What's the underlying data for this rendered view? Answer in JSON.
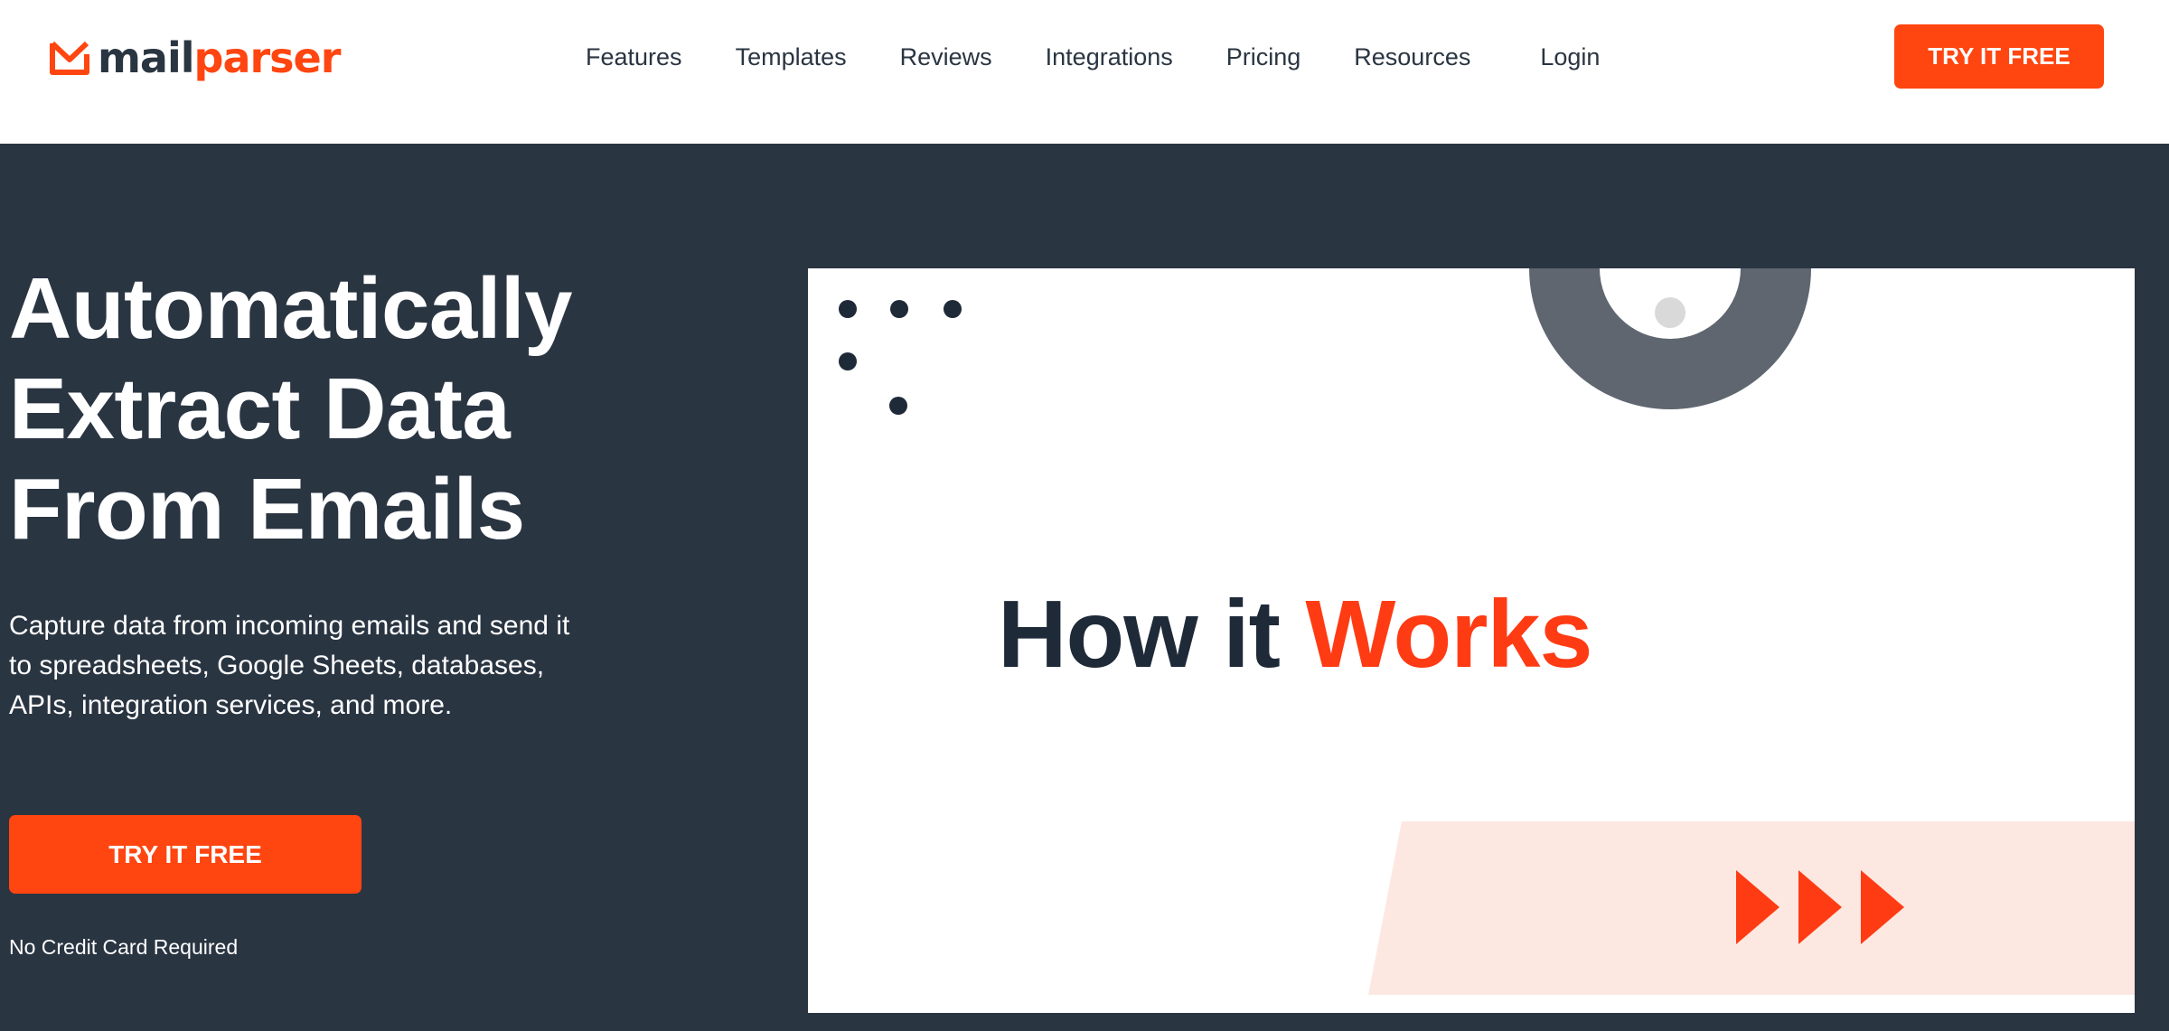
{
  "brand": {
    "logo_text_dark": "mail",
    "logo_text_accent": "parser",
    "accent_color": "#ff4510",
    "dark_color": "#2a3542"
  },
  "nav": {
    "items": [
      {
        "label": "Features"
      },
      {
        "label": "Templates"
      },
      {
        "label": "Reviews"
      },
      {
        "label": "Integrations"
      },
      {
        "label": "Pricing"
      },
      {
        "label": "Resources"
      }
    ],
    "login_label": "Login",
    "cta_label": "TRY IT FREE"
  },
  "hero": {
    "title_lines": [
      "Automatically",
      "Extract Data",
      "From Emails"
    ],
    "subtitle": "Capture data from incoming emails and send it to spreadsheets, Google Sheets, databases, APIs, integration services, and more.",
    "cta_label": "TRY IT FREE",
    "note": "No Credit Card Required"
  },
  "video": {
    "title_dark": "How it ",
    "title_accent": "Works",
    "play_icon": "triple-play-icon"
  }
}
